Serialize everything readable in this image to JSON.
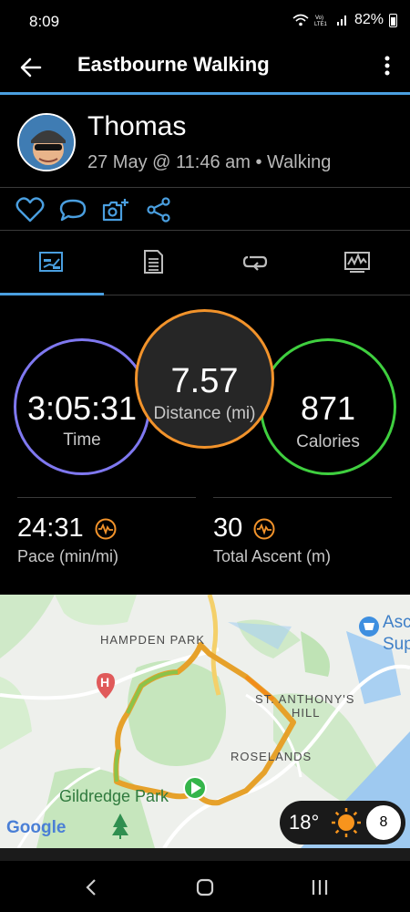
{
  "status": {
    "time": "8:09",
    "battery": "82%"
  },
  "app_bar": {
    "title": "Eastbourne Walking"
  },
  "header": {
    "user_name": "Thomas",
    "meta": "27 May @ 11:46 am • Walking"
  },
  "actions": [
    "heart-icon",
    "comment-icon",
    "add-photo-icon",
    "share-icon"
  ],
  "tabs": [
    {
      "name": "stats-tab",
      "icon": "chart-icon",
      "selected": true
    },
    {
      "name": "details-tab",
      "icon": "document-icon",
      "selected": false
    },
    {
      "name": "laps-tab",
      "icon": "repeat-icon",
      "selected": false
    },
    {
      "name": "graphs-tab",
      "icon": "graph-icon",
      "selected": false
    }
  ],
  "summary": {
    "time": {
      "value": "3:05:31",
      "label": "Time"
    },
    "distance": {
      "value": "7.57",
      "label": "Distance (mi)"
    },
    "calories": {
      "value": "871",
      "label": "Calories"
    }
  },
  "stats": {
    "pace": {
      "value": "24:31",
      "label": "Pace (min/mi)"
    },
    "ascent": {
      "value": "30",
      "label": "Total Ascent (m)"
    }
  },
  "map": {
    "labels": {
      "hampden_park": "HAMPDEN PARK",
      "st_anthonys": "ST. ANTHONY'S",
      "hill": "HILL",
      "roselands": "ROSELANDS",
      "gildredge_park": "Gildredge Park",
      "asda_1": "Asc",
      "asda_2": "Sup"
    },
    "attribution": "Google",
    "weather": {
      "temperature": "18°",
      "wind": "8"
    }
  },
  "colors": {
    "accent": "#4a9fe0",
    "time": "#7f78f0",
    "distance": "#f2932b",
    "calories": "#3fcf3f"
  }
}
